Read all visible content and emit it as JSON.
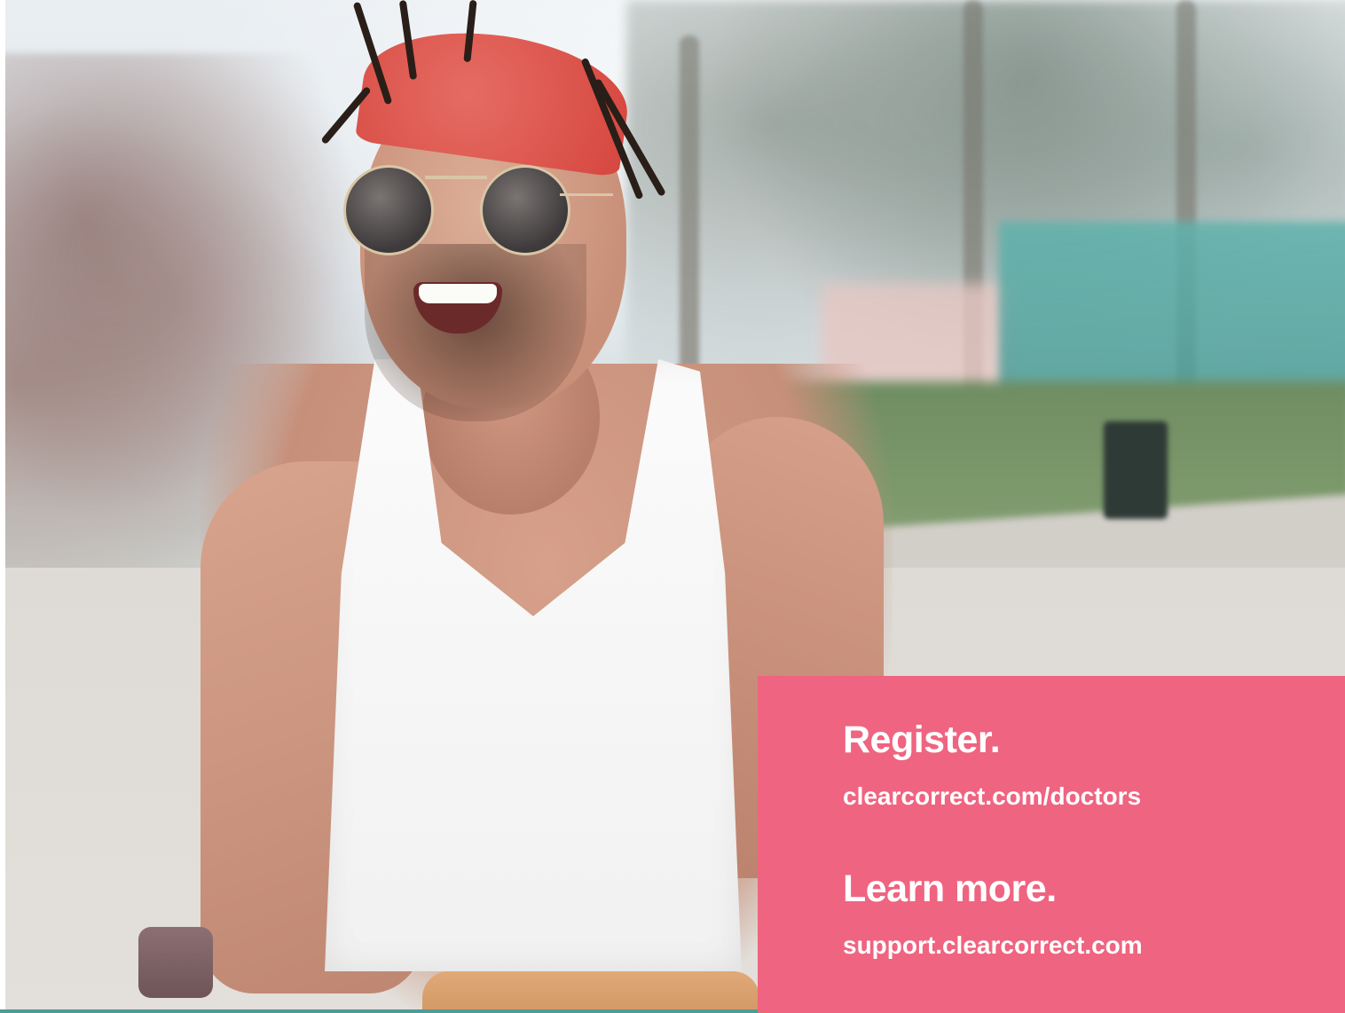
{
  "cta": {
    "register_heading": "Register.",
    "register_link": "clearcorrect.com/doctors",
    "learn_heading": "Learn more.",
    "learn_link": "support.clearcorrect.com",
    "panel_color": "#ef6480"
  }
}
